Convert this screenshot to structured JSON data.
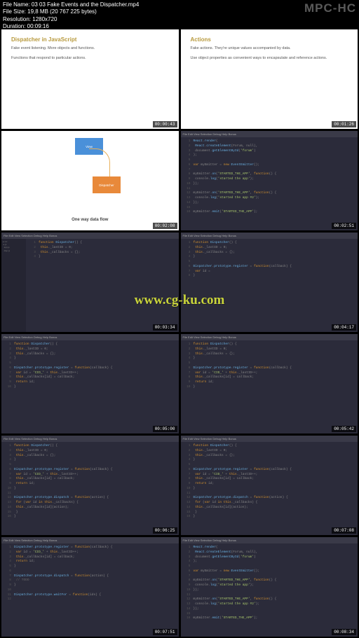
{
  "header": {
    "filename_label": "File Name: 03 03 Fake Events and the Dispatcher.mp4",
    "filesize_label": "File Size: 19,8 MB (20 767 225 bytes)",
    "resolution_label": "Resolution: 1280x720",
    "duration_label": "Duration: 00:09:16",
    "logo": "MPC-HC"
  },
  "watermark": "www.cg-ku.com",
  "thumbs": [
    {
      "type": "slide",
      "title": "Dispatcher in JavaScript",
      "line1": "Fake event listening. More objects and functions.",
      "line2": "Functions that respond to particular actions.",
      "time": "00:00:43"
    },
    {
      "type": "slide",
      "title": "Actions",
      "line1": "Fake actions. They're unique values accompanied by data.",
      "line2": "Use object properties as convenient ways to encapsulate and reference actions.",
      "time": "00:01:26"
    },
    {
      "type": "diagram",
      "view": "View",
      "dispatcher": "Dispatcher",
      "caption": "One way data flow",
      "time": "00:02:08"
    },
    {
      "type": "editor",
      "has_sidebar": false,
      "code": "react_render",
      "time": "00:02:51"
    },
    {
      "type": "editor",
      "has_sidebar": true,
      "code": "dispatcher_basic",
      "time": "00:03:34"
    },
    {
      "type": "editor",
      "has_sidebar": false,
      "code": "dispatcher_register",
      "time": "00:04:17"
    },
    {
      "type": "editor",
      "has_sidebar": false,
      "code": "dispatcher_register2",
      "time": "00:05:00"
    },
    {
      "type": "editor",
      "has_sidebar": false,
      "code": "dispatcher_register2",
      "time": "00:05:42"
    },
    {
      "type": "editor",
      "has_sidebar": false,
      "code": "dispatcher_dispatch",
      "time": "00:06:25"
    },
    {
      "type": "editor",
      "has_sidebar": false,
      "code": "dispatcher_dispatch",
      "time": "00:07:08"
    },
    {
      "type": "editor",
      "has_sidebar": false,
      "code": "dispatcher_waitfor",
      "time": "00:07:51"
    },
    {
      "type": "editor",
      "has_sidebar": false,
      "code": "react_render",
      "time": "00:08:34"
    }
  ],
  "menu": "File Edit View Selection Debug Help Bonus",
  "code_blocks": {
    "dispatcher_basic": [
      "function Dispatcher() {",
      "  this._lastID = 0;",
      "  this._callbacks = {};",
      "}"
    ],
    "dispatcher_register": [
      "function Dispatcher() {",
      "  this._lastID = 0;",
      "  this._callbacks = {};",
      "}",
      "",
      "Dispatcher.prototype.register = function(callback) {",
      "  var id = ",
      "}"
    ],
    "dispatcher_register2": [
      "function Dispatcher() {",
      "  this._lastID = 0;",
      "  this._callbacks = {};",
      "}",
      "",
      "Dispatcher.prototype.register = function(callback) {",
      "  var id = 'CID_' + this._lastID++;",
      "  this._callbacks[id] = callback;",
      "  return id;",
      "}"
    ],
    "dispatcher_dispatch": [
      "function Dispatcher() {",
      "  this._lastID = 0;",
      "  this._callbacks = {};",
      "}",
      "",
      "Dispatcher.prototype.register = function(callback) {",
      "  var id = 'CID_' + this._lastID++;",
      "  this._callbacks[id] = callback;",
      "  return id;",
      "}",
      "",
      "Dispatcher.prototype.dispatch = function(action) {",
      "  for (var id in this._callbacks) {",
      "    this._callbacks[id](action);",
      "  }",
      "}"
    ],
    "dispatcher_waitfor": [
      "Dispatcher.prototype.register = function(callback) {",
      "  var id = 'CID_' + this._lastID++;",
      "  this._callbacks[id] = callback;",
      "  return id;",
      "}",
      "",
      "Dispatcher.prototype.dispatch = function(action) {",
      "  // TODO",
      "}",
      "",
      "Dispatcher.prototype.waitFor = function(ids) {",
      ""
    ],
    "react_render": [
      "React.render(",
      "  React.createElement(Forum, null),",
      "  document.getElementById('forum')",
      ");",
      "",
      "var myEmitter = new EventEmitter();",
      "",
      "myEmitter.on('STARTED_THE_APP', function() {",
      "  console.log('started the app');",
      "});",
      "",
      "myEmitter.on('STARTED_THE_APP', function() {",
      "  console.log('started the app #2');",
      "});",
      "",
      "myEmitter.emit('STARTED_THE_APP');"
    ]
  }
}
